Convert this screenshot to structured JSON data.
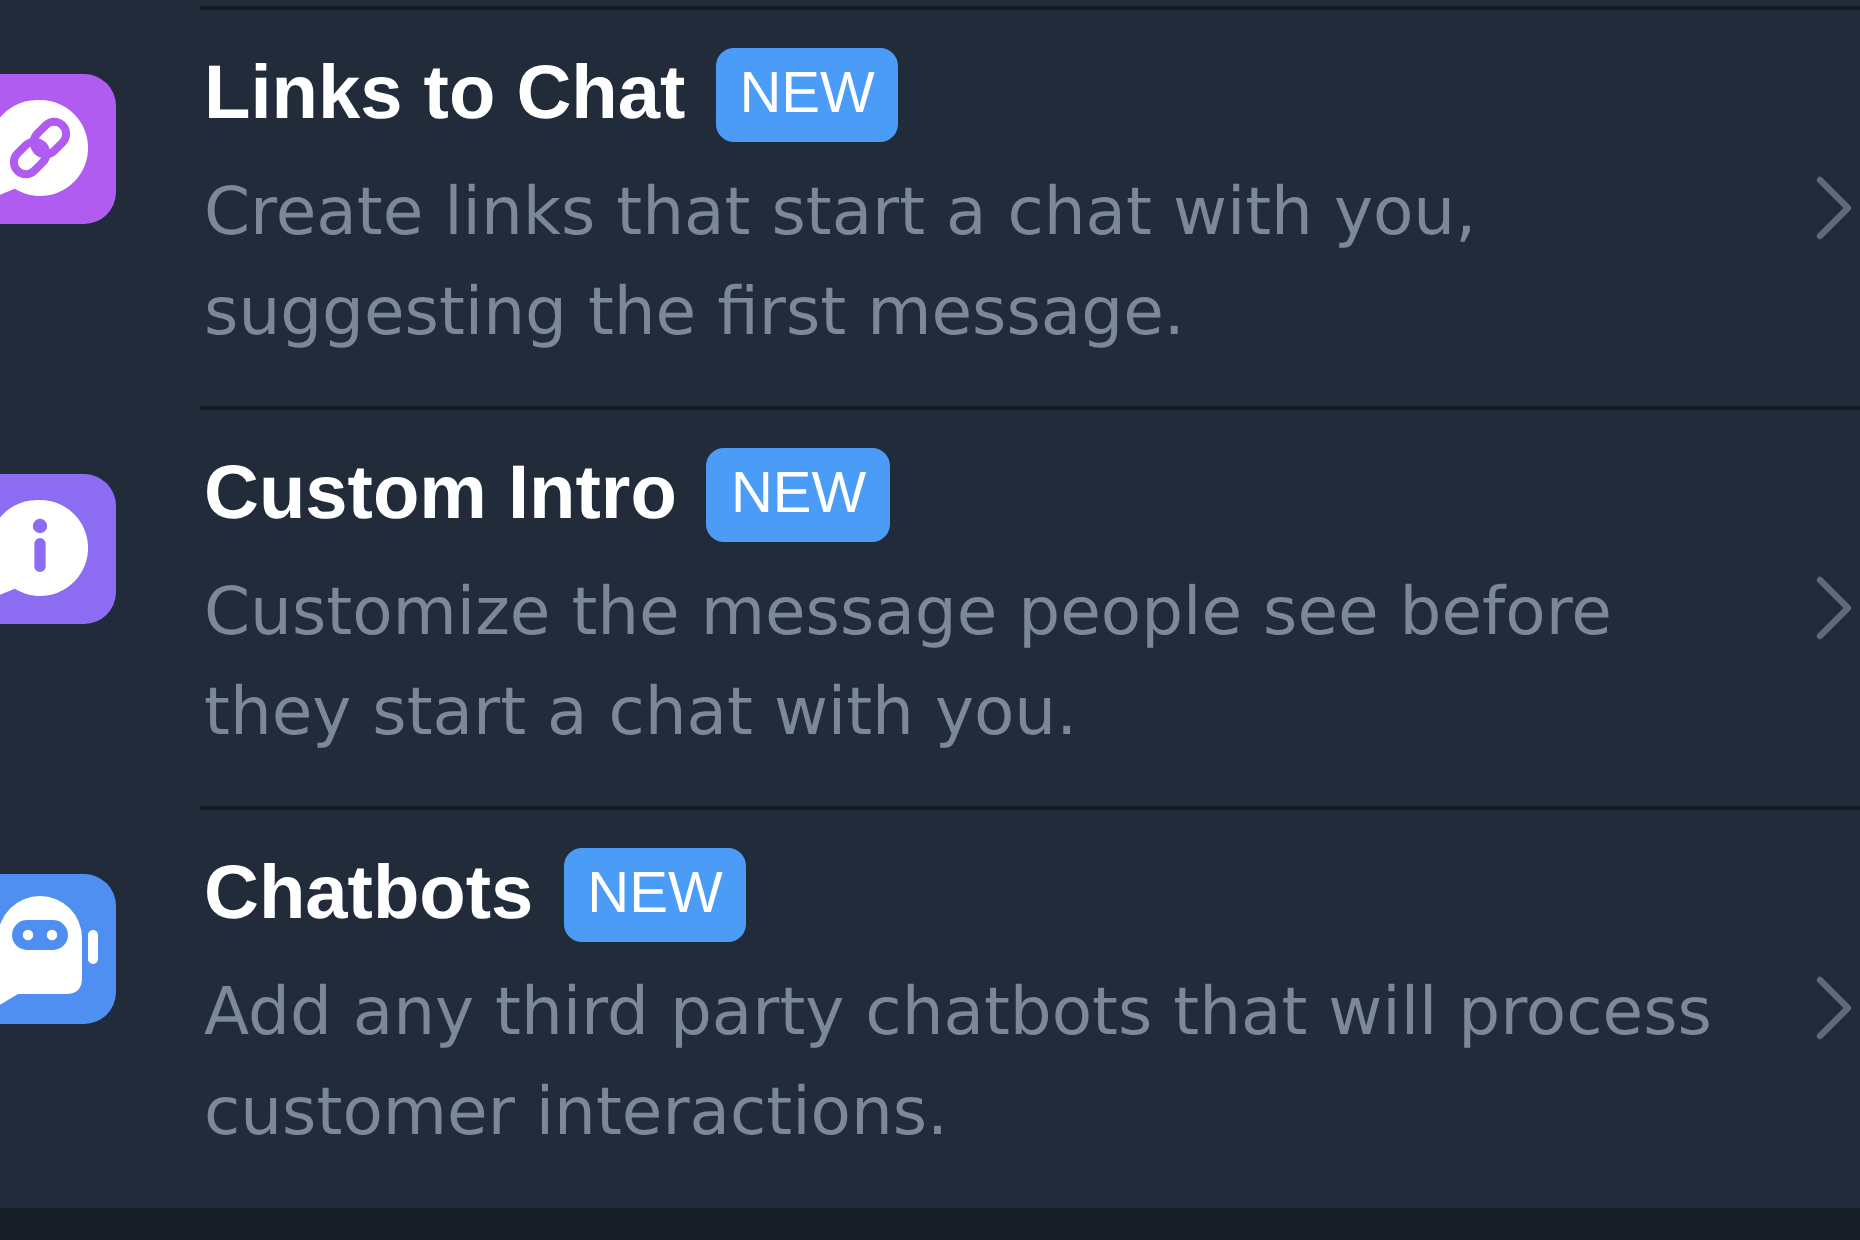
{
  "rows": [
    {
      "kind": "link",
      "color": "#b15cf1",
      "title": "Links to Chat",
      "badge": "NEW",
      "description": "Create links that start a chat with you,\nsuggesting the first message."
    },
    {
      "kind": "info",
      "color": "#8b6cf3",
      "title": "Custom Intro",
      "badge": "NEW",
      "description": "Customize the message people see before\nthey start a chat with you."
    },
    {
      "kind": "robot",
      "color": "#4f8ff1",
      "title": "Chatbots",
      "badge": "NEW",
      "description": "Add any third party chatbots that will process\ncustomer interactions."
    }
  ]
}
